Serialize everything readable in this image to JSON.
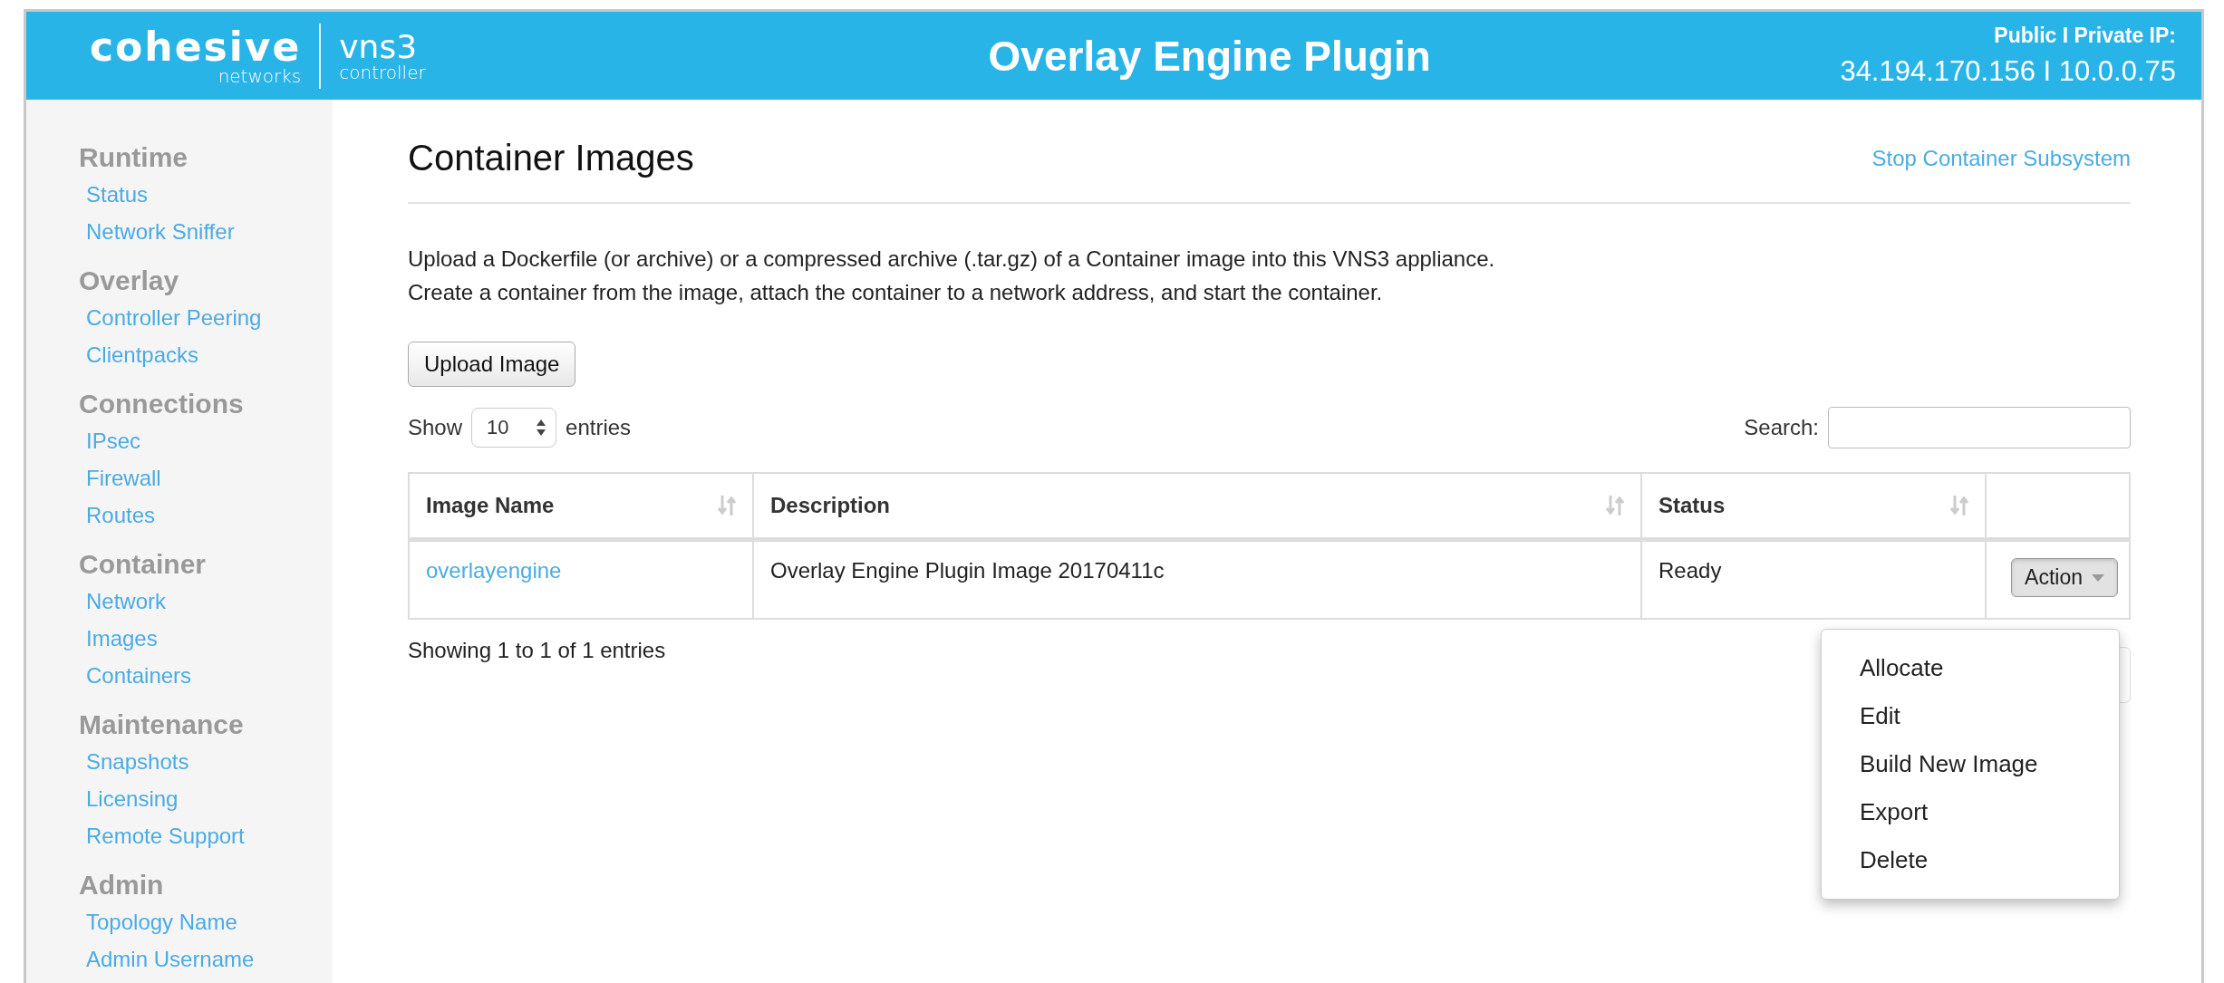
{
  "header": {
    "logo": {
      "brand": "cohesive",
      "brand_sub": "networks",
      "product": "vns3",
      "product_sub": "controller"
    },
    "title": "Overlay Engine Plugin",
    "ip_label": "Public I Private IP:",
    "ip_value": "34.194.170.156 I 10.0.0.75"
  },
  "sidebar": {
    "sections": [
      {
        "heading": "Runtime",
        "items": [
          "Status",
          "Network Sniffer"
        ]
      },
      {
        "heading": "Overlay",
        "items": [
          "Controller Peering",
          "Clientpacks"
        ]
      },
      {
        "heading": "Connections",
        "items": [
          "IPsec",
          "Firewall",
          "Routes"
        ]
      },
      {
        "heading": "Container",
        "items": [
          "Network",
          "Images",
          "Containers"
        ]
      },
      {
        "heading": "Maintenance",
        "items": [
          "Snapshots",
          "Licensing",
          "Remote Support"
        ]
      },
      {
        "heading": "Admin",
        "items": [
          "Topology Name",
          "Admin Username"
        ]
      }
    ]
  },
  "page": {
    "title": "Container Images",
    "action_link": "Stop Container Subsystem",
    "description": [
      "Upload a Dockerfile (or archive) or a compressed archive (.tar.gz) of a Container image into this VNS3 appliance.",
      "Create a container from the image, attach the container to a network address, and start the container."
    ],
    "upload_button": "Upload Image",
    "length": {
      "prefix": "Show",
      "value": "10",
      "suffix": "entries"
    },
    "search": {
      "label": "Search:"
    },
    "table": {
      "columns": [
        "Image Name",
        "Description",
        "Status"
      ],
      "rows": [
        {
          "image_name": "overlayengine",
          "description": "Overlay Engine Plugin Image 20170411c",
          "status": "Ready",
          "action": {
            "label": "Action",
            "expanded": true
          }
        }
      ]
    },
    "info": "Showing 1 to 1 of 1 entries",
    "action_menu": [
      "Allocate",
      "Edit",
      "Build New Image",
      "Export",
      "Delete"
    ]
  }
}
